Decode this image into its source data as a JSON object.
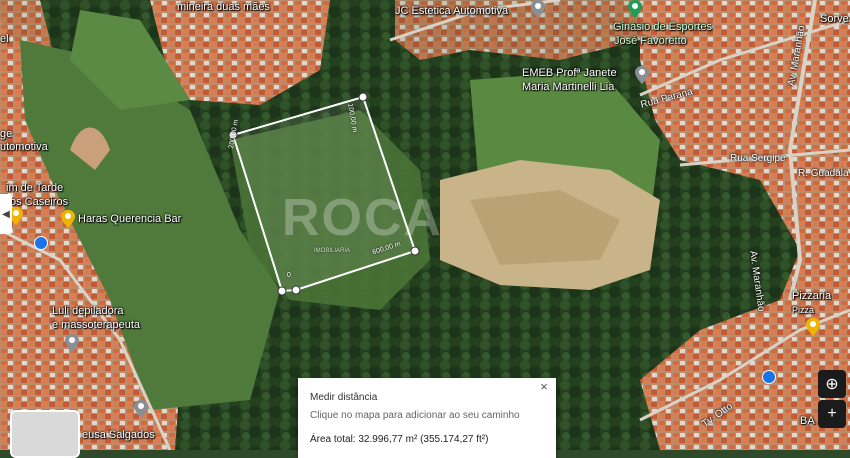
{
  "labels": {
    "mineira": "mineira duas mães",
    "jc": "JC Estetica Automotiva",
    "ginasio_1": "Ginásio de Esportes",
    "ginasio_2": "José Favoretto",
    "sorve": "Sorve",
    "emeb_1": "EMEB Profª Janete",
    "emeb_2": "Maria Martinelli Lia",
    "el": "el",
    "ge": "ge",
    "automotiva": "utomotiva",
    "im_de_tarde": "im de Tarde",
    "os_caseiros": "os Caseiros",
    "haras": "Haras Querencia Bar",
    "luli_1": "Luli depiladora",
    "luli_2": "e massoterapeuta",
    "pizzaria": "Pizzaria",
    "pizza": "Pizza",
    "salgados": "eusa Salgados",
    "ba": "BA"
  },
  "roads": {
    "parana": "Rua Parana",
    "sergipe": "Rua Sergipe",
    "guadala": "R. Guadala",
    "maranhao_1": "Av. Maranhão",
    "maranhao_2": "Av. Maranhão",
    "otto": "Tv. Otto"
  },
  "measurements": {
    "left_side": "200,00 m",
    "top_side": "100,00 m",
    "bottom_side": "600,00 m",
    "corner": "0"
  },
  "watermark": "ROCA",
  "watermark_sub": "IMOBILIARIA",
  "panel": {
    "title": "Medir distância",
    "hint": "Clique no mapa para adicionar ao seu caminho",
    "total": "Área total: 32.996,77 m² (355.174,27 ft²)",
    "close": "×"
  },
  "controls": {
    "locate": "⊕",
    "zoom_in": "+"
  },
  "colors": {
    "pin_yellow": "#f0b400",
    "pin_green": "#1e9e55",
    "pin_gray": "#8a8f95",
    "transit_blue": "#1a73e8"
  }
}
